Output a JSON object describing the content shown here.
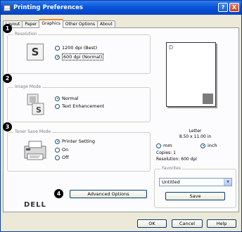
{
  "window": {
    "title": "Printing Preferences",
    "help_glyph": "?",
    "close_glyph": "X"
  },
  "tabs": [
    {
      "label": "Layout",
      "active": false
    },
    {
      "label": "Paper",
      "active": false
    },
    {
      "label": "Graphics",
      "active": true
    },
    {
      "label": "Other Options",
      "active": false
    },
    {
      "label": "About",
      "active": false
    }
  ],
  "badges": [
    "1",
    "2",
    "3",
    "4"
  ],
  "resolution": {
    "label": "Resolution",
    "icon_letter": "S",
    "options": [
      {
        "label": "1200 dpi (Best)",
        "checked": false
      },
      {
        "label": "600 dpi (Normal)",
        "checked": true
      }
    ]
  },
  "image_mode": {
    "label": "Image Mode",
    "icon_letter": "S",
    "options": [
      {
        "label": "Normal",
        "checked": true
      },
      {
        "label": "Text Enhancement",
        "checked": false
      }
    ]
  },
  "toner_save": {
    "label": "Toner Save Mode",
    "options": [
      {
        "label": "Printer Setting",
        "checked": true
      },
      {
        "label": "On",
        "checked": false
      },
      {
        "label": "Off",
        "checked": false
      }
    ]
  },
  "advanced_button": "Advanced Options",
  "preview": {
    "page_letter": "D",
    "paper_name": "Letter",
    "paper_size": "8.50 x 11.00 in",
    "units": [
      {
        "label": "mm",
        "checked": false
      },
      {
        "label": "inch",
        "checked": true
      }
    ],
    "copies": "Copies: 1",
    "resolution": "Resolution: 600 dpi"
  },
  "favorites": {
    "label": "Favorites",
    "selected": "Untitled",
    "save_button": "Save"
  },
  "logo": "DELL",
  "footer": {
    "ok": "OK",
    "cancel": "Cancel",
    "help": "Help"
  }
}
